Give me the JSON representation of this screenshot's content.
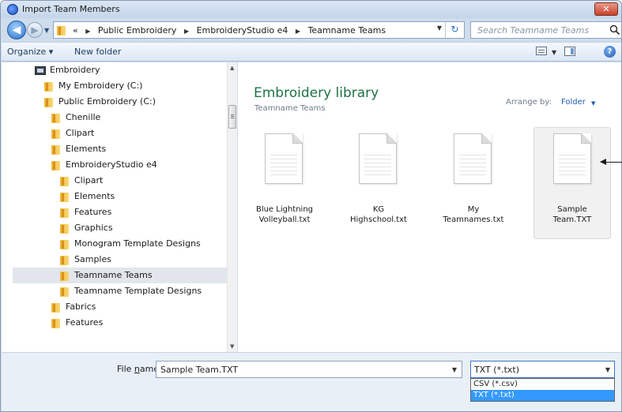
{
  "window": {
    "title": "Import Team Members",
    "close_label": "✕"
  },
  "nav": {
    "back_glyph": "◀",
    "forward_glyph": "▶"
  },
  "address": {
    "overflow": "«",
    "crumbs": [
      "Public Embroidery",
      "EmbroideryStudio e4",
      "Teamname Teams"
    ],
    "separator": "▸"
  },
  "search": {
    "placeholder": "Search Teamname Teams"
  },
  "toolbar": {
    "organize_label": "Organize ▾",
    "new_folder_label": "New folder",
    "help_label": "?"
  },
  "tree": {
    "root_label": "Embroidery",
    "items": [
      {
        "label": "My Embroidery (C:)"
      },
      {
        "label": "Public Embroidery (C:)"
      },
      {
        "label": "Chenille"
      },
      {
        "label": "Clipart"
      },
      {
        "label": "Elements"
      },
      {
        "label": "EmbroideryStudio e4"
      },
      {
        "label": "Clipart"
      },
      {
        "label": "Elements"
      },
      {
        "label": "Features"
      },
      {
        "label": "Graphics"
      },
      {
        "label": "Monogram Template Designs"
      },
      {
        "label": "Samples"
      },
      {
        "label": "Teamname Teams",
        "selected": true
      },
      {
        "label": "Teamname Template Designs"
      },
      {
        "label": "Fabrics"
      },
      {
        "label": "Features"
      }
    ]
  },
  "library": {
    "title": "Embroidery library",
    "subtitle": "Teamname Teams",
    "arrange_label": "Arrange by:",
    "arrange_value": "Folder"
  },
  "files": [
    {
      "line1": "Blue Lightning",
      "line2": "Volleyball.txt"
    },
    {
      "line1": "KG",
      "line2": "Highschool.txt"
    },
    {
      "line1": "My",
      "line2": "Teamnames.txt"
    },
    {
      "line1": "Sample",
      "line2": "Team.TXT",
      "selected": true
    }
  ],
  "bottom": {
    "filename_label_pre": "File ",
    "filename_label_u": "n",
    "filename_label_post": "ame:",
    "filename_value": "Sample Team.TXT",
    "filetype_value": "TXT (*.txt)",
    "filetype_options": [
      "CSV (*.csv)",
      "TXT (*.txt)"
    ],
    "filetype_highlighted_index": 1
  },
  "colors": {
    "library_title": "#1e7145",
    "selection_blue": "#3399ff",
    "link_blue": "#1e5bb5"
  }
}
